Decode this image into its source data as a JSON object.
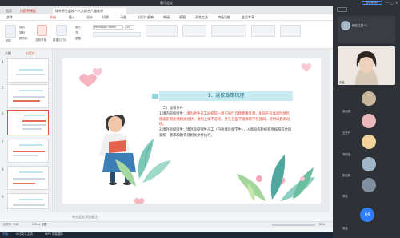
{
  "meeting": {
    "title": "腾讯会议",
    "rec_label": "正在录制中",
    "window_controls": [
      "—",
      "□",
      "✕"
    ]
  },
  "tabs": [
    "首页",
    "找稻壳模板",
    "境外师生返校—八大综合六强化课"
  ],
  "menus": [
    "文件",
    "开始",
    "插入",
    "设计",
    "切换",
    "动画",
    "幻灯片放映",
    "审阅",
    "视图",
    "开发工具",
    "特色功能",
    "会员专享"
  ],
  "active_menu": "开始",
  "toolbar": {
    "paste": "粘贴",
    "cut": "剪切",
    "copy": "复制",
    "format": "格式刷",
    "from_current": "当前开始",
    "new_slide": "新建幻灯片",
    "layout": "版式",
    "section": "节",
    "font": "Microsoft YaHei",
    "size": "20",
    "reset": "重置"
  },
  "panel": {
    "tab1": "大纲",
    "tab2": "幻灯片",
    "thumb_numbers": [
      "4",
      "5",
      "6",
      "7",
      "8",
      "9"
    ],
    "selected": "7"
  },
  "slide": {
    "header": "1、返校政策梳理",
    "section": "（二）返校条件",
    "line1_black": "1.境内返校师生：",
    "line1_red": "境内师生员工返校前一周应进行自我健康监测，如尚在有高风险地区旅居史和疫情相关症状，须到上报不返校，并先在医学观察和学校通知，待时间后再返校。",
    "line2_black": "2.境外返校师生：境外返校师生员工（包括境外留学生），入境返校防疫程序按照符合国家统一要求和教育部相关文件执行。"
  },
  "notes": "单击此处添加备注",
  "status": {
    "slide": "幻灯片 7/18",
    "theme": "Office 主题",
    "zoom": "78%"
  },
  "taskbar": [
    "开始",
    "AI中文本主流",
    "WPS 华智国际"
  ],
  "participants": [
    {
      "name": "杨健(主持人)",
      "kind": "host"
    },
    {
      "name": "于鑫",
      "kind": "video"
    },
    {
      "name": "吴雨辰",
      "kind": "avatar",
      "color": "#c9b49c"
    },
    {
      "name": "王丹丹",
      "kind": "avatar",
      "color": "#e9b8b8"
    },
    {
      "name": "刘欣怡",
      "kind": "avatar",
      "color": "#f2d39a"
    },
    {
      "name": "陈雨婷",
      "kind": "avatar",
      "color": "#9fb6c9"
    },
    {
      "name": "李晓",
      "kind": "avatar",
      "color": "#7f8ea0"
    },
    {
      "name": "张晨",
      "kind": "avatar",
      "color": "#b4c7a6"
    }
  ],
  "more_count": "64",
  "colors": {
    "accent": "#2f7cf6",
    "wps_red": "#d04a2b",
    "header_bg": "#c8ecf1"
  }
}
